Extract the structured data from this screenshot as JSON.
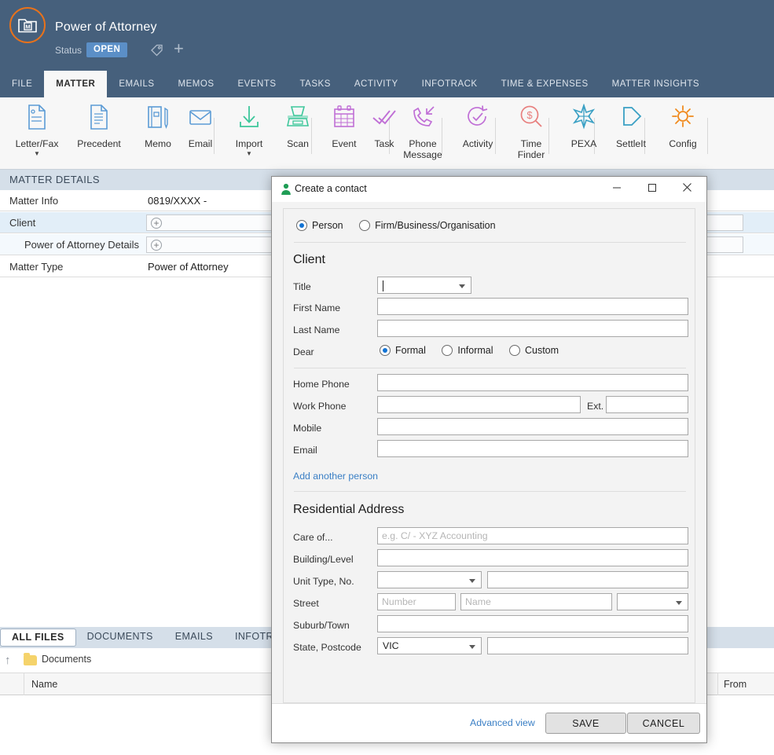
{
  "header": {
    "logo_letter": "M",
    "matter_title": "Power of Attorney",
    "status_label": "Status",
    "status_value": "OPEN",
    "accent_orange": "#e8721b",
    "navy": "#46607c",
    "status_pill_blue": "#5b8fc7"
  },
  "nav_tabs": [
    {
      "label": "FILE",
      "active": false
    },
    {
      "label": "MATTER",
      "active": true
    },
    {
      "label": "EMAILS",
      "active": false
    },
    {
      "label": "MEMOS",
      "active": false
    },
    {
      "label": "EVENTS",
      "active": false
    },
    {
      "label": "TASKS",
      "active": false
    },
    {
      "label": "ACTIVITY",
      "active": false
    },
    {
      "label": "INFOTRACK",
      "active": false
    },
    {
      "label": "TIME & EXPENSES",
      "active": false
    },
    {
      "label": "MATTER INSIGHTS",
      "active": false
    }
  ],
  "ribbon": [
    {
      "label": "Letter/Fax",
      "icon": "document-page-icon",
      "color": "#5b9bd5",
      "caret": true
    },
    {
      "label": "Precedent",
      "icon": "document-lines-icon",
      "color": "#5b9bd5",
      "caret": false
    },
    {
      "label": "Memo",
      "icon": "notebook-pen-icon",
      "color": "#5b9bd5",
      "caret": false
    },
    {
      "label": "Email",
      "icon": "envelope-icon",
      "color": "#5b9bd5",
      "caret": false
    },
    {
      "label": "Import",
      "icon": "download-arrow-icon",
      "color": "#3ec79b",
      "caret": true
    },
    {
      "label": "Scan",
      "icon": "scanner-icon",
      "color": "#3ec79b",
      "caret": false
    },
    {
      "label": "Event",
      "icon": "calendar-icon",
      "color": "#c06fd6",
      "caret": false
    },
    {
      "label": "Task",
      "icon": "double-check-icon",
      "color": "#c06fd6",
      "caret": false
    },
    {
      "label": "Phone Message",
      "icon": "phone-incoming-icon",
      "color": "#c06fd6",
      "caret": false
    },
    {
      "label": "Activity",
      "icon": "clock-check-icon",
      "color": "#c06fd6",
      "caret": false
    },
    {
      "label": "Time Finder",
      "icon": "dollar-magnifier-icon",
      "color": "#e8807f",
      "caret": false
    },
    {
      "label": "PEXA",
      "icon": "pexa-star-icon",
      "color": "#3aa0c4",
      "caret": false
    },
    {
      "label": "SettleIt",
      "icon": "arrow-flag-icon",
      "color": "#3aa0c4",
      "caret": false
    },
    {
      "label": "Config",
      "icon": "gear-icon",
      "color": "#f08a1e",
      "caret": false
    }
  ],
  "matter_details": {
    "section_title": "MATTER DETAILS",
    "rows": [
      {
        "label": "Matter Info",
        "value": "0819/XXXX -",
        "type": "text",
        "indent": false,
        "highlight": false
      },
      {
        "label": "Client",
        "value": "",
        "type": "add",
        "indent": false,
        "highlight": true
      },
      {
        "label": "Power of Attorney Details",
        "value": "",
        "type": "add",
        "indent": true,
        "highlight": false
      },
      {
        "label": "Matter Type",
        "value": "Power of Attorney",
        "type": "text",
        "indent": false,
        "highlight": false
      }
    ]
  },
  "file_tabs": [
    {
      "label": "ALL FILES",
      "active": true
    },
    {
      "label": "DOCUMENTS",
      "active": false
    },
    {
      "label": "EMAILS",
      "active": false
    },
    {
      "label": "INFOTRACK",
      "active": false
    }
  ],
  "breadcrumb": {
    "folder": "Documents"
  },
  "file_grid": {
    "columns": [
      "Name",
      "From"
    ]
  },
  "dialog": {
    "title": "Create a contact",
    "title_icon": "person-icon",
    "window_buttons": {
      "minimize": "—",
      "maximize": "☐",
      "close": "✕"
    },
    "contact_type": {
      "options": [
        {
          "label": "Person",
          "selected": true
        },
        {
          "label": "Firm/Business/Organisation",
          "selected": false
        }
      ]
    },
    "client_section": {
      "heading": "Client",
      "title_field": {
        "label": "Title",
        "value": "",
        "focused": true
      },
      "first_name": {
        "label": "First Name",
        "value": ""
      },
      "last_name": {
        "label": "Last Name",
        "value": ""
      },
      "dear": {
        "label": "Dear",
        "options": [
          {
            "label": "Formal",
            "selected": true
          },
          {
            "label": "Informal",
            "selected": false
          },
          {
            "label": "Custom",
            "selected": false
          }
        ]
      }
    },
    "contact_section": {
      "home_phone": {
        "label": "Home Phone",
        "value": ""
      },
      "work_phone": {
        "label": "Work Phone",
        "value": ""
      },
      "ext": {
        "label": "Ext.",
        "value": ""
      },
      "mobile": {
        "label": "Mobile",
        "value": ""
      },
      "email": {
        "label": "Email",
        "value": ""
      },
      "add_another": "Add another person"
    },
    "address_section": {
      "heading": "Residential Address",
      "care_of": {
        "label": "Care of...",
        "value": "",
        "placeholder": "e.g. C/ - XYZ Accounting"
      },
      "building_level": {
        "label": "Building/Level",
        "value": ""
      },
      "unit_type_no": {
        "label": "Unit Type, No.",
        "unit_type_value": "",
        "unit_no_value": ""
      },
      "street": {
        "label": "Street",
        "number_placeholder": "Number",
        "name_placeholder": "Name",
        "type_value": ""
      },
      "suburb_town": {
        "label": "Suburb/Town",
        "value": ""
      },
      "state_postcode": {
        "label": "State, Postcode",
        "state_value": "VIC",
        "postcode_value": ""
      }
    },
    "footer": {
      "advanced_view": "Advanced view",
      "save": "SAVE",
      "cancel": "CANCEL"
    }
  }
}
